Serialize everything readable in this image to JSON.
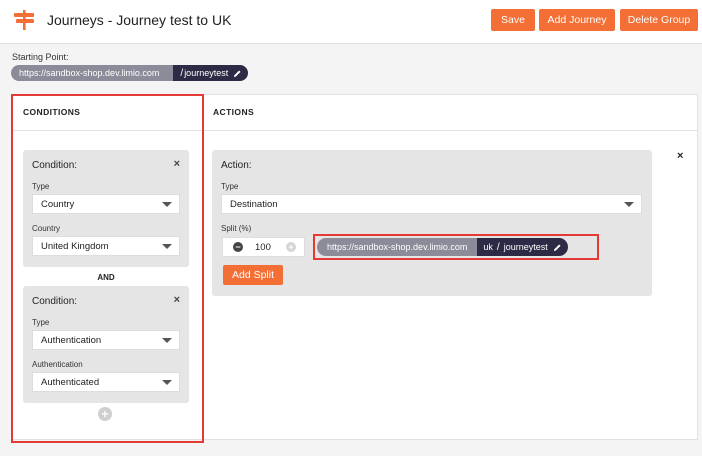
{
  "header": {
    "title": "Journeys - Journey test to UK",
    "buttons": {
      "save": "Save",
      "add_journey": "Add Journey",
      "delete_group": "Delete Group"
    },
    "logo_icon": "signpost-icon",
    "accent_color": "#f36f36"
  },
  "starting_point": {
    "label": "Starting Point:",
    "url": "https://sandbox-shop.dev.limio.com",
    "slash": "/",
    "path": "journeytest"
  },
  "conditions": {
    "title": "CONDITIONS",
    "join_label": "AND",
    "items": [
      {
        "title": "Condition:",
        "close": "×",
        "type_label": "Type",
        "type_value": "Country",
        "value_label": "Country",
        "value": "United Kingdom"
      },
      {
        "title": "Condition:",
        "close": "×",
        "type_label": "Type",
        "type_value": "Authentication",
        "value_label": "Authentication",
        "value": "Authenticated"
      }
    ],
    "add_icon": "+"
  },
  "actions": {
    "title": "ACTIONS",
    "close": "×",
    "action": {
      "title": "Action:",
      "type_label": "Type",
      "type_value": "Destination",
      "split_label": "Split (%)",
      "split_value": "100",
      "minus": "−",
      "plus": "+",
      "destination": {
        "url": "https://sandbox-shop.dev.limio.com",
        "slash": "/",
        "segment": "uk",
        "path": "journeytest"
      },
      "add_split": "Add Split"
    }
  },
  "colors": {
    "highlight": "#e53935",
    "pill_url": "#8b8b9a",
    "pill_dark": "#2c2a45"
  }
}
